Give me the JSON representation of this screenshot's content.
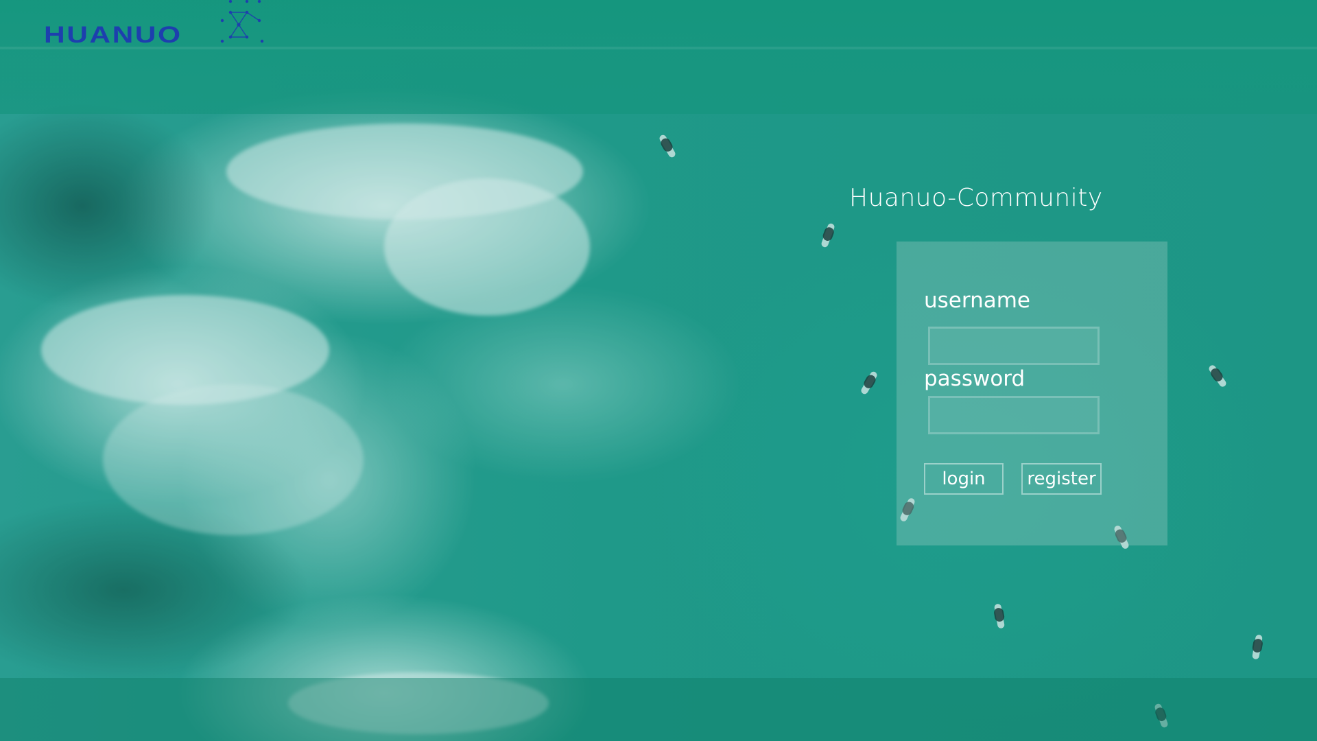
{
  "header": {
    "logo_text": "HUANUO",
    "logo_icon": "network-nodes-icon",
    "logo_color": "#1d3fae"
  },
  "login": {
    "site_title": "Huanuo-Community",
    "username_label": "username",
    "username_value": "",
    "password_label": "password",
    "password_value": "",
    "login_button": "login",
    "register_button": "register"
  },
  "colors": {
    "ocean": "#1e9a89",
    "header": "#14967d",
    "text": "#ffffff"
  }
}
